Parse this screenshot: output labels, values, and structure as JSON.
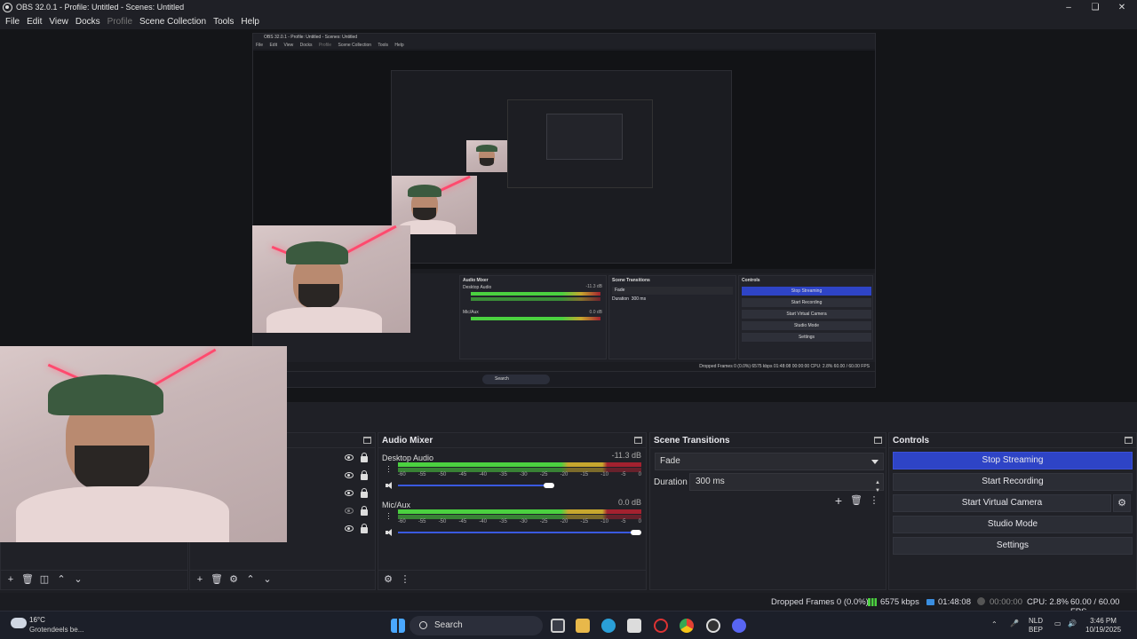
{
  "window": {
    "title": "OBS 32.0.1 - Profile: Untitled - Scenes: Untitled",
    "controls": [
      "minimize",
      "maximize",
      "close"
    ]
  },
  "menu": [
    "File",
    "Edit",
    "View",
    "Docks",
    "Profile",
    "Scene Collection",
    "Tools",
    "Help"
  ],
  "nested": {
    "title": "OBS 32.0.1 - Profile: Untitled - Scenes: Untitled",
    "menu": [
      "File",
      "Edit",
      "View",
      "Docks",
      "Profile",
      "Scene Collection",
      "Tools",
      "Help"
    ],
    "docks": {
      "mixer": "Audio Mixer",
      "transitions": "Scene Transitions",
      "controls": "Controls"
    },
    "mixer_channels": [
      "Desktop Audio",
      "Mic/Aux"
    ],
    "mixer_db": [
      "-11.3 dB",
      "0.0 dB"
    ],
    "transition": "Fade",
    "duration_label": "Duration",
    "duration": "300 ms",
    "buttons": [
      "Stop Streaming",
      "Start Recording",
      "Start Virtual Camera",
      "Studio Mode",
      "Settings"
    ],
    "status": "Dropped Frames 0 (0.0%)   6575 kbps   01:48:08   00:00:00   CPU: 2.8%   60.00 / 60.00 FPS",
    "search": "Search"
  },
  "docks": {
    "audio_mixer": {
      "title": "Audio Mixer",
      "channels": [
        {
          "name": "Desktop Audio",
          "db": "-11.3 dB",
          "level": 0.67,
          "volume": 0.62
        },
        {
          "name": "Mic/Aux",
          "db": "0.0 dB",
          "level": 0.77,
          "volume": 1.0
        }
      ],
      "scale": [
        "-60",
        "-55",
        "-50",
        "-45",
        "-40",
        "-35",
        "-30",
        "-25",
        "-20",
        "-15",
        "-10",
        "-5",
        "0"
      ]
    },
    "scene_transitions": {
      "title": "Scene Transitions",
      "transition": "Fade",
      "duration_label": "Duration",
      "duration": "300 ms"
    },
    "controls": {
      "title": "Controls",
      "buttons": [
        "Stop Streaming",
        "Start Recording",
        "Start Virtual Camera",
        "Studio Mode",
        "Settings"
      ]
    }
  },
  "status": {
    "dropped_frames": "Dropped Frames 0 (0.0%)",
    "bitrate": "6575 kbps",
    "stream_time": "01:48:08",
    "record_time": "00:00:00",
    "cpu": "CPU: 2.8%",
    "fps": "60.00 / 60.00 FPS"
  },
  "taskbar": {
    "weather_temp": "16°C",
    "weather_desc": "Grotendeels be...",
    "search": "Search",
    "lang": "NLD",
    "layout": "BEP",
    "time": "3:46 PM",
    "date": "10/19/2025"
  },
  "colors": {
    "accent": "#2e44c6",
    "meter_green": "#4bd140",
    "meter_yellow": "#c7a72e",
    "meter_red": "#a3212f",
    "neon": "#ff4a6e"
  }
}
